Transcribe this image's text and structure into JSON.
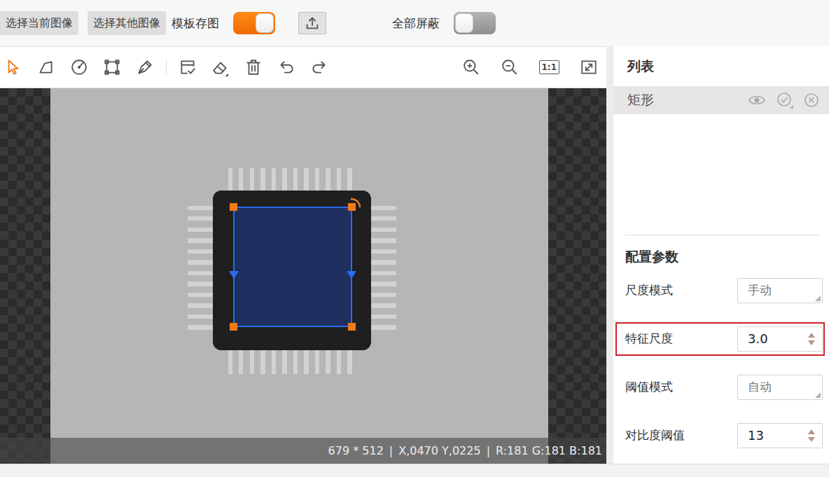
{
  "top_bar": {
    "buttons": [
      "选择当前图像",
      "选择其他图像"
    ],
    "controls": [
      {
        "kind": "switch",
        "label": "模板存图",
        "on": true
      },
      {
        "kind": "upload"
      },
      {
        "kind": "switch",
        "label": "全部屏蔽",
        "on": false
      }
    ]
  },
  "toolbar": {
    "tools": [
      {
        "selected": true
      },
      {
        "selected": false
      },
      {
        "selected": false
      },
      {
        "selected": false
      },
      {
        "selected": false
      },
      {
        "selected": false
      },
      {
        "selected": false
      },
      {
        "selected": false
      },
      {
        "selected": false
      },
      {
        "selected": false
      }
    ],
    "actual_size": "1:1"
  },
  "canvas": {
    "status": [
      "679 * 512",
      "X,0470 Y,0225",
      "R:181 G:181 B:181"
    ],
    "separator": "|"
  },
  "list": {
    "title": "列表",
    "items": [
      {
        "name": "矩形",
        "selected": true
      }
    ]
  },
  "config": {
    "title": "配置参数",
    "params": [
      {
        "label": "尺度模式",
        "value": "手动",
        "kind": "select",
        "highlighted": false
      },
      {
        "label": "特征尺度",
        "value": "3.0",
        "kind": "spinner",
        "highlighted": true
      },
      {
        "label": "阈值模式",
        "value": "自动",
        "kind": "select",
        "highlighted": false
      },
      {
        "label": "对比度阈值",
        "value": "13",
        "kind": "spinner",
        "highlighted": false
      }
    ]
  }
}
